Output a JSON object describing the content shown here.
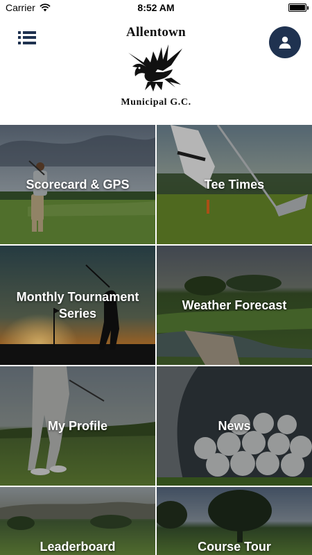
{
  "status_bar": {
    "carrier": "Carrier",
    "time": "8:52 AM",
    "icons": [
      "wifi-icon",
      "battery-icon"
    ],
    "battery_level": 1.0
  },
  "header": {
    "logo_top": "Allentown",
    "logo_bottom": "Municipal G.C.",
    "menu_icon": "menu-list-icon",
    "profile_icon": "user-icon",
    "accent_color": "#1f3250"
  },
  "tiles": [
    {
      "label": "Scorecard & GPS"
    },
    {
      "label": "Tee Times"
    },
    {
      "label": "Monthly Tournament Series"
    },
    {
      "label": "Weather Forecast"
    },
    {
      "label": "My Profile"
    },
    {
      "label": "News"
    },
    {
      "label": "Leaderboard"
    },
    {
      "label": "Course Tour"
    }
  ]
}
